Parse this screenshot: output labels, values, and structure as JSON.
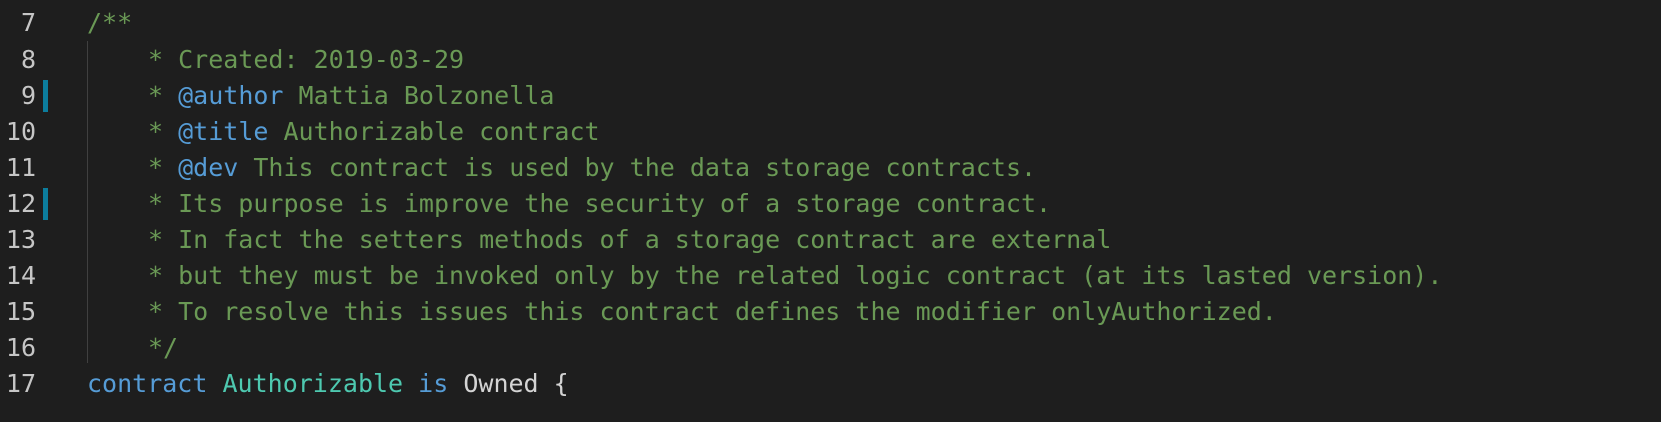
{
  "colors": {
    "background": "#1e1e1e",
    "line_number": "#c6c6c6",
    "comment": "#6a9955",
    "doc_tag": "#569cd6",
    "keyword": "#569cd6",
    "type": "#4ec9b0",
    "plain": "#d4d4d4",
    "change_bar": "#0c7d9d"
  },
  "lines": [
    {
      "number": "7",
      "text": "/**",
      "modified": false
    },
    {
      "number": "8",
      "text": "* Created: 2019-03-29",
      "modified": false
    },
    {
      "number": "9",
      "prefix": "* ",
      "tag": "@author",
      "rest": " Mattia Bolzonella",
      "modified": true
    },
    {
      "number": "10",
      "prefix": "* ",
      "tag": "@title",
      "rest": " Authorizable contract",
      "modified": false
    },
    {
      "number": "11",
      "prefix": "* ",
      "tag": "@dev",
      "rest": " This contract is used by the data storage contracts.",
      "modified": false
    },
    {
      "number": "12",
      "text": "* Its purpose is improve the security of a storage contract.",
      "modified": true
    },
    {
      "number": "13",
      "text": "* In fact the setters methods of a storage contract are external",
      "modified": false
    },
    {
      "number": "14",
      "text": "* but they must be invoked only by the related logic contract (at its lasted version).",
      "modified": false
    },
    {
      "number": "15",
      "text": "* To resolve this issues this contract defines the modifier onlyAuthorized.",
      "modified": false
    },
    {
      "number": "16",
      "text": "*/",
      "modified": false
    },
    {
      "number": "17",
      "kw1": "contract",
      "name": "Authorizable",
      "kw2": "is",
      "base": "Owned",
      "brace": "{",
      "modified": false
    }
  ]
}
